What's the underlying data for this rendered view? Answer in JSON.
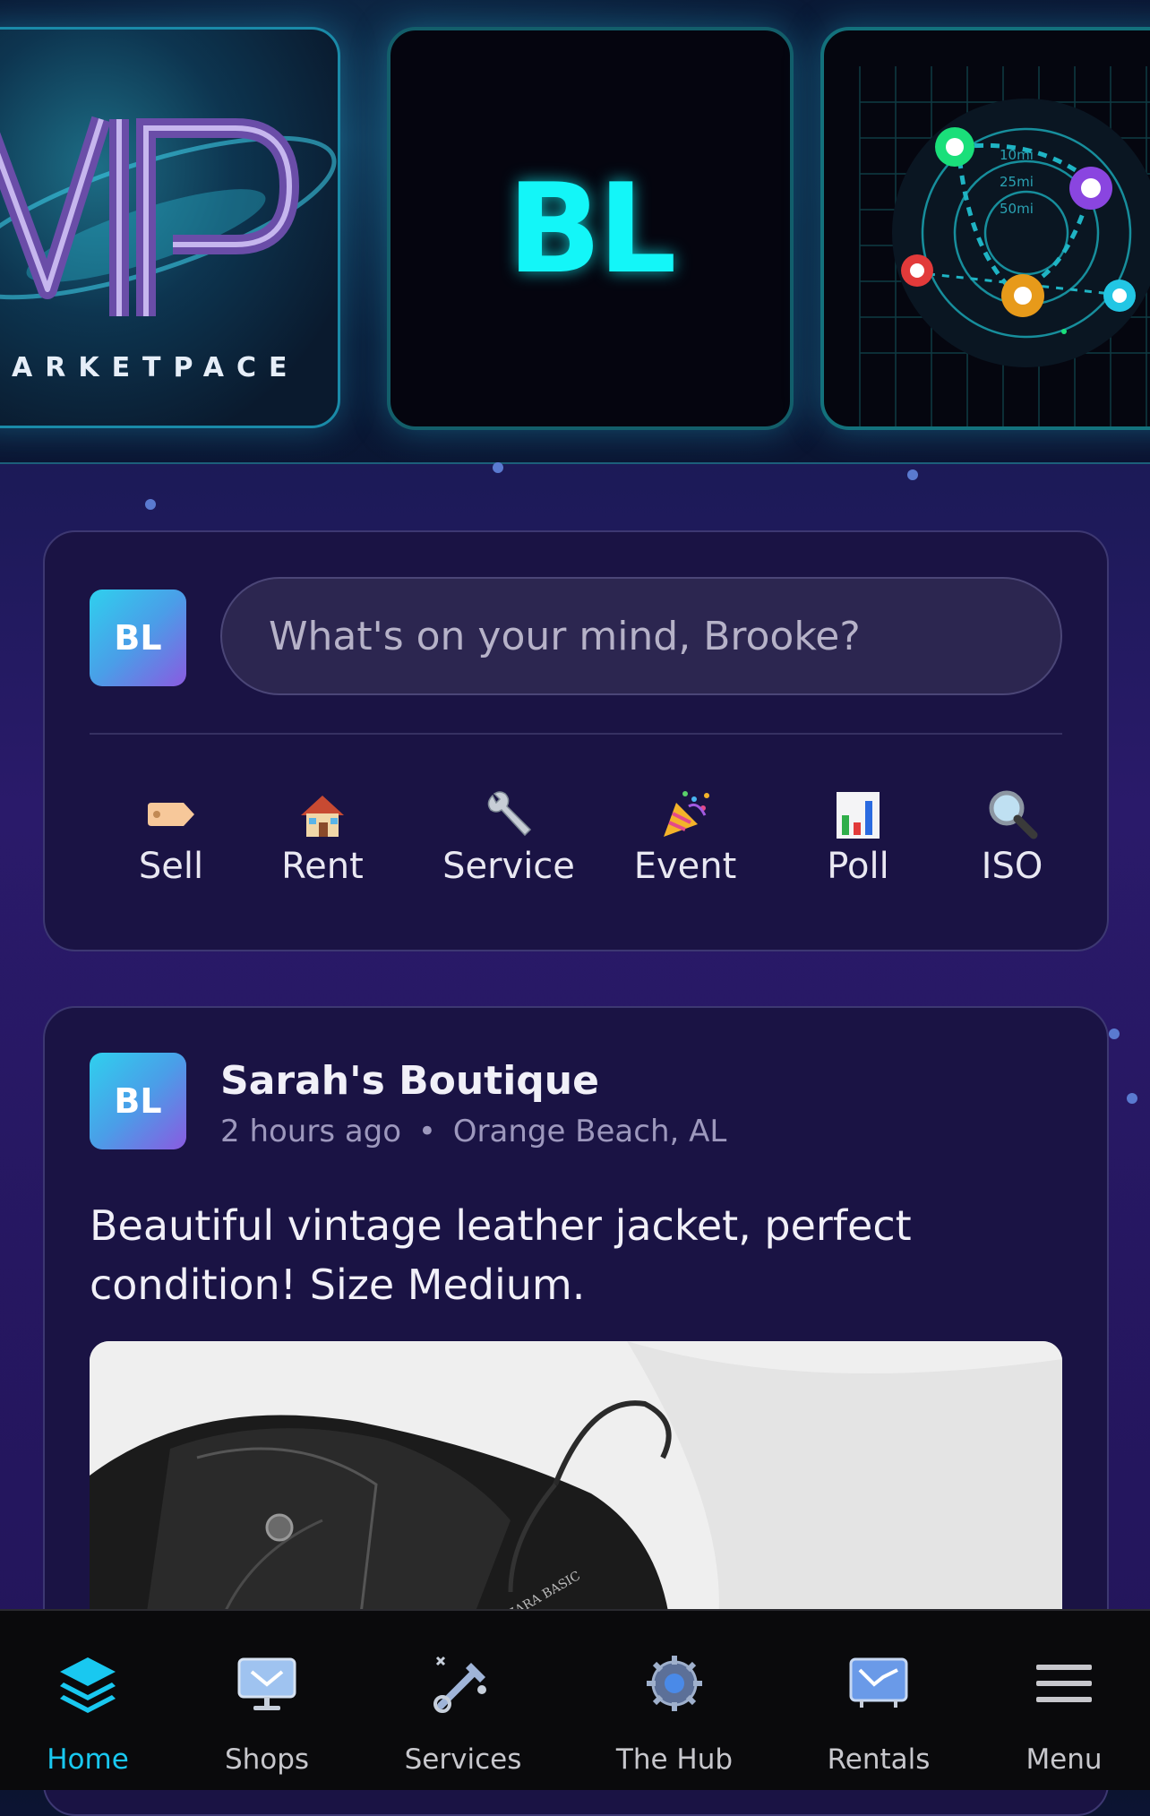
{
  "header": {
    "tiles": [
      {
        "name": "marketplace-logo",
        "text": "ARKETPACE"
      },
      {
        "name": "initials-tile",
        "text": "BL"
      },
      {
        "name": "radius-map",
        "rings": [
          "10mi",
          "25mi",
          "50mi"
        ]
      }
    ]
  },
  "composer": {
    "avatar_initials": "BL",
    "placeholder": "What's on your mind, Brooke?",
    "actions": [
      {
        "label": "Sell",
        "icon": "tag-icon"
      },
      {
        "label": "Rent",
        "icon": "house-icon"
      },
      {
        "label": "Service",
        "icon": "wrench-icon"
      },
      {
        "label": "Event",
        "icon": "party-popper-icon"
      },
      {
        "label": "Poll",
        "icon": "bar-chart-icon"
      },
      {
        "label": "ISO",
        "icon": "magnifier-icon"
      }
    ]
  },
  "post": {
    "avatar_initials": "BL",
    "author": "Sarah's Boutique",
    "time": "2 hours ago",
    "separator": "•",
    "location": "Orange Beach, AL",
    "body": "Beautiful vintage leather jacket, perfect condition! Size Medium.",
    "image_label": "ZARA BASIC"
  },
  "tabbar": {
    "tabs": [
      {
        "label": "Home",
        "icon": "layers-icon",
        "active": true
      },
      {
        "label": "Shops",
        "icon": "monitor-icon",
        "active": false
      },
      {
        "label": "Services",
        "icon": "tools-icon",
        "active": false
      },
      {
        "label": "The Hub",
        "icon": "hub-gear-icon",
        "active": false
      },
      {
        "label": "Rentals",
        "icon": "rentals-screen-icon",
        "active": false
      },
      {
        "label": "Menu",
        "icon": "hamburger-icon",
        "active": false
      }
    ]
  },
  "colors": {
    "accent": "#19c8f0",
    "card_bg": "#1a1344",
    "bl_neon": "#13f6f8"
  }
}
